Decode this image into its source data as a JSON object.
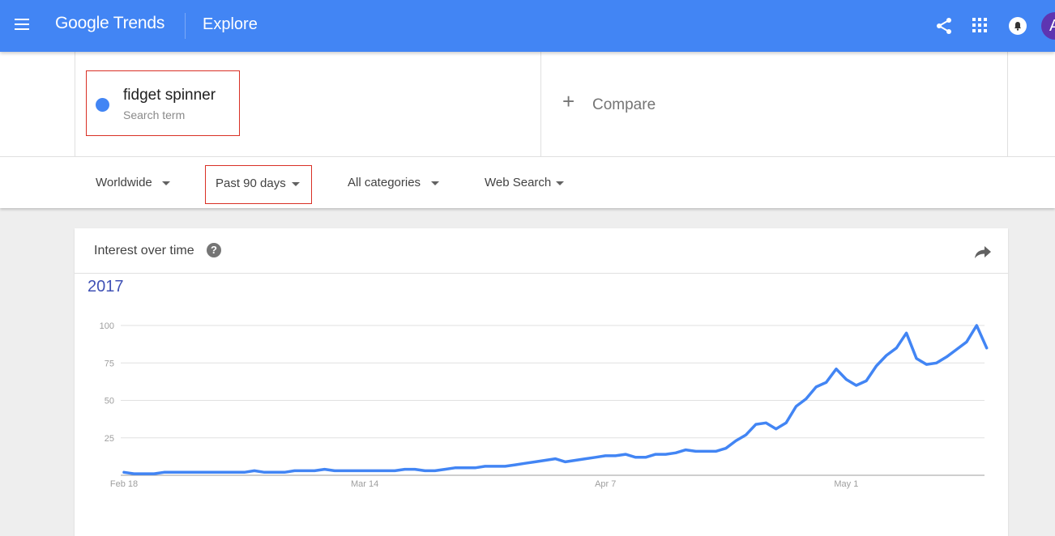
{
  "header": {
    "logo_text": "Google Trends",
    "page_name": "Explore",
    "avatar_initial": "A",
    "colors": {
      "brand": "#4285f4",
      "avatar": "#5e35b1"
    }
  },
  "search": {
    "term": "fidget spinner",
    "term_type": "Search term",
    "term_color": "#4285f4",
    "compare_label": "Compare"
  },
  "filters": {
    "region": "Worldwide",
    "time_range": "Past 90 days",
    "category": "All categories",
    "search_type": "Web Search"
  },
  "card": {
    "title": "Interest over time",
    "help_glyph": "?",
    "year_label": "2017"
  },
  "chart_data": {
    "type": "line",
    "title": "Interest over time",
    "xlabel": "",
    "ylabel": "",
    "ylim": [
      0,
      100
    ],
    "grid": true,
    "y_ticks": [
      25,
      50,
      75,
      100
    ],
    "x_tick_labels": [
      {
        "label": "Feb 18",
        "index": 0
      },
      {
        "label": "Mar 14",
        "index": 24
      },
      {
        "label": "Apr 7",
        "index": 48
      },
      {
        "label": "May 1",
        "index": 72
      }
    ],
    "x_start": "2017-02-18",
    "series": [
      {
        "name": "fidget spinner",
        "color": "#4285f4",
        "values": [
          2,
          1,
          1,
          1,
          2,
          2,
          2,
          2,
          2,
          2,
          2,
          2,
          2,
          3,
          2,
          2,
          2,
          3,
          3,
          3,
          4,
          3,
          3,
          3,
          3,
          3,
          3,
          3,
          4,
          4,
          3,
          3,
          4,
          5,
          5,
          5,
          6,
          6,
          6,
          7,
          8,
          9,
          10,
          11,
          9,
          10,
          11,
          12,
          13,
          13,
          14,
          12,
          12,
          14,
          14,
          15,
          17,
          16,
          16,
          16,
          18,
          23,
          27,
          34,
          35,
          31,
          35,
          46,
          51,
          59,
          62,
          71,
          64,
          60,
          63,
          73,
          80,
          85,
          95,
          78,
          74,
          75,
          79,
          84,
          89,
          100,
          85
        ]
      }
    ]
  }
}
